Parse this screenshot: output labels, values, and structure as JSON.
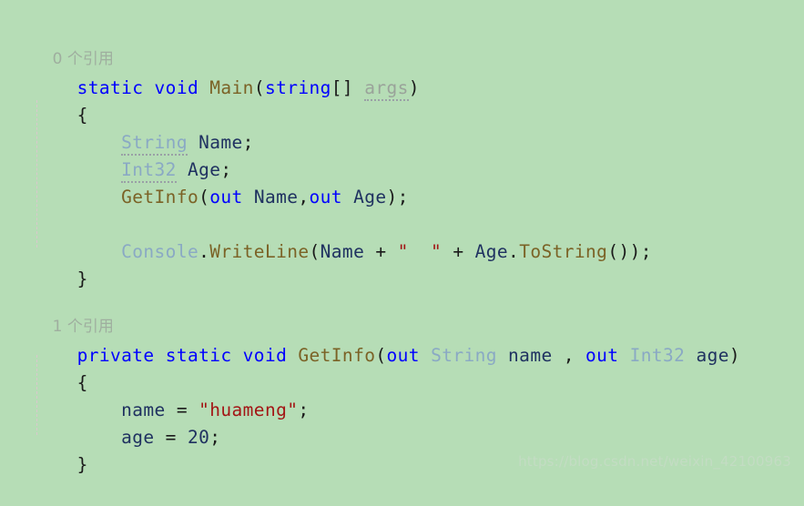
{
  "editor": {
    "language": "csharp",
    "background_color": "#b6ddb6",
    "colors": {
      "keyword": "#0000ff",
      "method": "#7b6226",
      "type": "#8aa9c4",
      "local_variable": "#1f3160",
      "string_literal": "#a31515",
      "punctuation": "#1a1a1a",
      "codelens_text": "#9fae9f",
      "unused_parameter": "#9aa39a",
      "indent_guide": "#d9c8cc",
      "watermark": "#c3dcc3"
    }
  },
  "codelens": {
    "main_references": "0 个引用",
    "getinfo_references": "1 个引用"
  },
  "code": {
    "l1": {
      "kw_static": "static",
      "sp1": " ",
      "kw_void": "void",
      "sp2": " ",
      "method_main": "Main",
      "paren_open": "(",
      "kw_string": "string",
      "brackets": "[]",
      "sp3": " ",
      "param_args": "args",
      "paren_close": ")"
    },
    "l2": {
      "brace_open": "{"
    },
    "l3": {
      "indent": "    ",
      "type_string": "String",
      "sp": " ",
      "var_name": "Name",
      "semi": ";"
    },
    "l4": {
      "indent": "    ",
      "type_int32": "Int32",
      "sp": " ",
      "var_age": "Age",
      "semi": ";"
    },
    "l5": {
      "indent": "    ",
      "method_getinfo": "GetInfo",
      "paren_open": "(",
      "kw_out1": "out",
      "sp1": " ",
      "var_name": "Name",
      "comma": ",",
      "kw_out2": "out",
      "sp2": " ",
      "var_age": "Age",
      "paren_close": ")",
      "semi": ";"
    },
    "l6": {
      "indent": "    ",
      "type_console": "Console",
      "dot1": ".",
      "method_writeline": "WriteLine",
      "paren_open": "(",
      "var_name": "Name",
      "plus1": " + ",
      "string_space": "\"  \"",
      "plus2": " + ",
      "var_age": "Age",
      "dot2": ".",
      "method_tostring": "ToString",
      "parens": "()",
      "paren_close": ")",
      "semi": ";"
    },
    "l7": {
      "brace_close": "}"
    },
    "l8": {
      "kw_private": "private",
      "sp1": " ",
      "kw_static": "static",
      "sp2": " ",
      "kw_void": "void",
      "sp3": " ",
      "method_getinfo": "GetInfo",
      "paren_open": "(",
      "kw_out1": "out",
      "sp4": " ",
      "type_string": "String",
      "sp5": " ",
      "param_name": "name",
      "comma": " , ",
      "kw_out2": "out",
      "sp6": " ",
      "type_int32": "Int32",
      "sp7": " ",
      "param_age": "age",
      "paren_close": ")"
    },
    "l9": {
      "brace_open": "{"
    },
    "l10": {
      "indent": "    ",
      "param_name": "name",
      "assign": " = ",
      "string_huameng": "\"huameng\"",
      "semi": ";"
    },
    "l11": {
      "indent": "    ",
      "param_age": "age",
      "assign": " = ",
      "number_20": "20",
      "semi": ";"
    },
    "l12": {
      "brace_close": "}"
    }
  },
  "watermark": {
    "url": "https://blog.csdn.net/weixin_42100963"
  }
}
